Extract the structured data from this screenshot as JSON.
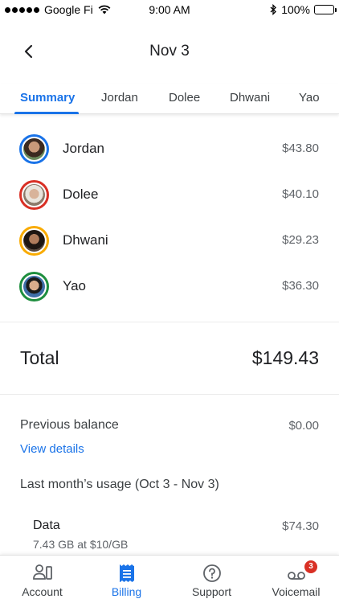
{
  "status_bar": {
    "carrier": "Google Fi",
    "time": "9:00 AM",
    "battery": "100%"
  },
  "header": {
    "title": "Nov 3"
  },
  "tabs": [
    {
      "label": "Summary",
      "active": true
    },
    {
      "label": "Jordan",
      "active": false
    },
    {
      "label": "Dolee",
      "active": false
    },
    {
      "label": "Dhwani",
      "active": false
    },
    {
      "label": "Yao",
      "active": false
    }
  ],
  "people": [
    {
      "name": "Jordan",
      "amount": "$43.80",
      "ring_color": "#1a73e8"
    },
    {
      "name": "Dolee",
      "amount": "$40.10",
      "ring_color": "#d93025"
    },
    {
      "name": "Dhwani",
      "amount": "$29.23",
      "ring_color": "#f9ab00"
    },
    {
      "name": "Yao",
      "amount": "$36.30",
      "ring_color": "#1e8e3e"
    }
  ],
  "total": {
    "label": "Total",
    "amount": "$149.43"
  },
  "previous_balance": {
    "label": "Previous balance",
    "amount": "$0.00",
    "link": "View details"
  },
  "usage": {
    "title": "Last month’s usage (Oct 3 - Nov 3)",
    "data_label": "Data",
    "data_amount": "$74.30",
    "data_detail": "7.43 GB at $10/GB"
  },
  "bottom_nav": [
    {
      "label": "Account",
      "icon": "account-icon",
      "active": false
    },
    {
      "label": "Billing",
      "icon": "billing-icon",
      "active": true
    },
    {
      "label": "Support",
      "icon": "help-icon",
      "active": false
    },
    {
      "label": "Voicemail",
      "icon": "voicemail-icon",
      "active": false,
      "badge": "3"
    }
  ],
  "colors": {
    "accent": "#1a73e8",
    "badge": "#d93025"
  }
}
